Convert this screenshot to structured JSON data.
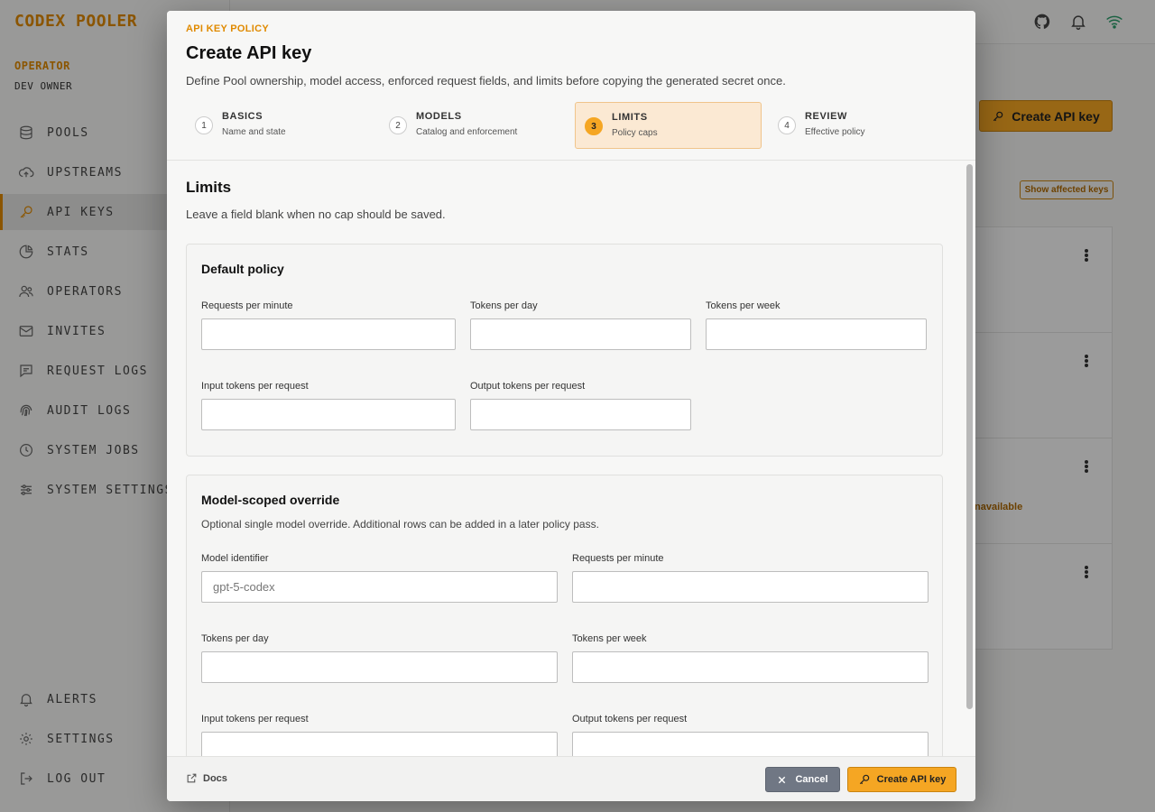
{
  "app": {
    "brand": "CODEX POOLER",
    "role": "OPERATOR",
    "user": "DEV OWNER"
  },
  "nav": {
    "items": [
      {
        "label": "POOLS",
        "icon": "database-icon"
      },
      {
        "label": "UPSTREAMS",
        "icon": "cloud-upload-icon"
      },
      {
        "label": "API KEYS",
        "icon": "key-icon",
        "active": true
      },
      {
        "label": "STATS",
        "icon": "pie-chart-icon"
      },
      {
        "label": "OPERATORS",
        "icon": "users-icon"
      },
      {
        "label": "INVITES",
        "icon": "mail-icon"
      },
      {
        "label": "REQUEST LOGS",
        "icon": "message-icon"
      },
      {
        "label": "AUDIT LOGS",
        "icon": "fingerprint-icon"
      },
      {
        "label": "SYSTEM JOBS",
        "icon": "clock-icon"
      },
      {
        "label": "SYSTEM SETTINGS",
        "icon": "sliders-icon"
      }
    ],
    "bottom": [
      {
        "label": "ALERTS",
        "icon": "bell-icon"
      },
      {
        "label": "SETTINGS",
        "icon": "gear-icon"
      },
      {
        "label": "LOG OUT",
        "icon": "logout-icon"
      }
    ]
  },
  "background": {
    "create_button": "Create API key",
    "affected_button": "Show affected keys",
    "unavailable_text": "navailable"
  },
  "modal": {
    "eyebrow": "API KEY POLICY",
    "title": "Create API key",
    "description": "Define Pool ownership, model access, enforced request fields, and limits before copying the generated secret once.",
    "steps": [
      {
        "num": "1",
        "title": "BASICS",
        "subtitle": "Name and state"
      },
      {
        "num": "2",
        "title": "MODELS",
        "subtitle": "Catalog and enforcement"
      },
      {
        "num": "3",
        "title": "LIMITS",
        "subtitle": "Policy caps",
        "active": true
      },
      {
        "num": "4",
        "title": "REVIEW",
        "subtitle": "Effective policy"
      }
    ],
    "section": {
      "title": "Limits",
      "description": "Leave a field blank when no cap should be saved."
    },
    "default_policy": {
      "title": "Default policy",
      "requests_per_minute": {
        "label": "Requests per minute",
        "value": ""
      },
      "tokens_per_day": {
        "label": "Tokens per day",
        "value": ""
      },
      "tokens_per_week": {
        "label": "Tokens per week",
        "value": ""
      },
      "input_tokens_per_request": {
        "label": "Input tokens per request",
        "value": ""
      },
      "output_tokens_per_request": {
        "label": "Output tokens per request",
        "value": ""
      }
    },
    "model_override": {
      "title": "Model-scoped override",
      "description": "Optional single model override. Additional rows can be added in a later policy pass.",
      "model_identifier": {
        "label": "Model identifier",
        "placeholder": "gpt-5-codex",
        "value": ""
      },
      "requests_per_minute": {
        "label": "Requests per minute",
        "value": ""
      },
      "tokens_per_day": {
        "label": "Tokens per day",
        "value": ""
      },
      "tokens_per_week": {
        "label": "Tokens per week",
        "value": ""
      },
      "input_tokens_per_request": {
        "label": "Input tokens per request",
        "value": ""
      },
      "output_tokens_per_request": {
        "label": "Output tokens per request",
        "value": ""
      }
    },
    "footer": {
      "docs_label": "Docs",
      "cancel_label": "Cancel",
      "create_label": "Create API key"
    }
  },
  "colors": {
    "accent": "#f5a623",
    "accent_text": "#e08a00",
    "active_step_bg": "#fbe9d3",
    "cancel_bg": "#707784"
  }
}
